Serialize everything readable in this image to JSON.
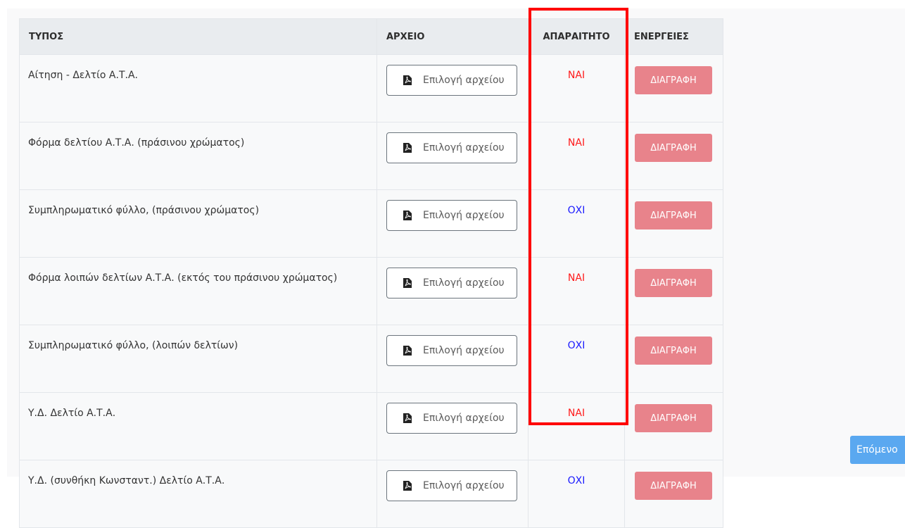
{
  "table": {
    "headers": {
      "type": "ΤΥΠΟΣ",
      "file": "ΑΡΧΕΙΟ",
      "required": "ΑΠΑΡΑΙΤΗΤΟ",
      "actions": "ΕΝΕΡΓΕΙΕΣ"
    },
    "rows": [
      {
        "type": "Αίτηση - Δελτίο Α.Τ.Α.",
        "file_button": "Επιλογή αρχείου",
        "required": "ΝΑΙ",
        "action": "ΔΙΑΓΡΑΦΗ"
      },
      {
        "type": "Φόρμα δελτίου Α.Τ.Α. (πράσινου χρώματος)",
        "file_button": "Επιλογή αρχείου",
        "required": "ΝΑΙ",
        "action": "ΔΙΑΓΡΑΦΗ"
      },
      {
        "type": "Συμπληρωματικό φύλλο, (πράσινου χρώματος)",
        "file_button": "Επιλογή αρχείου",
        "required": "ΟΧΙ",
        "action": "ΔΙΑΓΡΑΦΗ"
      },
      {
        "type": "Φόρμα λοιπών δελτίων Α.Τ.Α. (εκτός του πράσινου χρώματος)",
        "file_button": "Επιλογή αρχείου",
        "required": "ΝΑΙ",
        "action": "ΔΙΑΓΡΑΦΗ"
      },
      {
        "type": "Συμπληρωματικό φύλλο, (λοιπών δελτίων)",
        "file_button": "Επιλογή αρχείου",
        "required": "ΟΧΙ",
        "action": "ΔΙΑΓΡΑΦΗ"
      },
      {
        "type": "Υ.Δ. Δελτίο Α.Τ.Α.",
        "file_button": "Επιλογή αρχείου",
        "required": "ΝΑΙ",
        "action": "ΔΙΑΓΡΑΦΗ"
      },
      {
        "type": "Υ.Δ. (συνθήκη Κωνσταντ.) Δελτίο Α.Τ.Α.",
        "file_button": "Επιλογή αρχείου",
        "required": "ΟΧΙ",
        "action": "ΔΙΑΓΡΑΦΗ"
      }
    ],
    "file_icon": "pdf-file-icon"
  },
  "next_button": "Επόμενο",
  "colors": {
    "required_yes": "#ff1a1a",
    "required_no": "#1a1aff",
    "delete_button": "#e8838b",
    "next_button": "#5aa8f0",
    "highlight": "#ff0000"
  }
}
